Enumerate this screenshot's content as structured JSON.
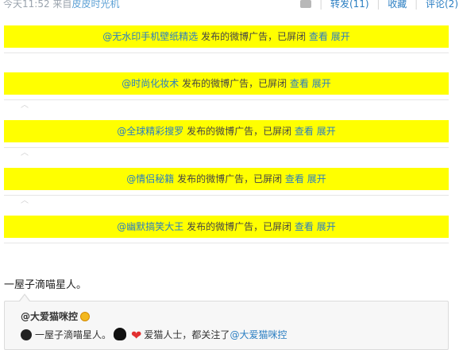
{
  "post_meta": {
    "time": "今天11:52",
    "source_prefix": "来自",
    "source": "皮皮时光机"
  },
  "actions": {
    "repost": "转发(11)",
    "favorite": "收藏",
    "comment": "评论(2)"
  },
  "ads": [
    {
      "user": "@无水印手机壁纸精选",
      "text": " 发布的微博广告，已屏闭 ",
      "view": "查看",
      "expand": "展开"
    },
    {
      "user": "@时尚化妆术",
      "text": " 发布的微博广告，已屏闭 ",
      "view": "查看",
      "expand": "展开"
    },
    {
      "user": "@全球精彩搜罗",
      "text": " 发布的微博广告，已屏闭 ",
      "view": "查看",
      "expand": "展开"
    },
    {
      "user": "@情侣秘籍",
      "text": " 发布的微博广告，已屏闭 ",
      "view": "查看",
      "expand": "展开"
    },
    {
      "user": "@幽默搞笑大王",
      "text": " 发布的微博广告，已屏闭 ",
      "view": "查看",
      "expand": "展开"
    }
  ],
  "post": {
    "text": "一屋子滴喵星人。"
  },
  "quote": {
    "user": "@大爱猫咪控",
    "text_a": "一屋子滴喵星人。",
    "text_b": "爱猫人士，都关注了",
    "mention": "@大爱猫咪控"
  },
  "colors": {
    "ad_background": "#ffff00",
    "link": "#2a7ec2"
  }
}
